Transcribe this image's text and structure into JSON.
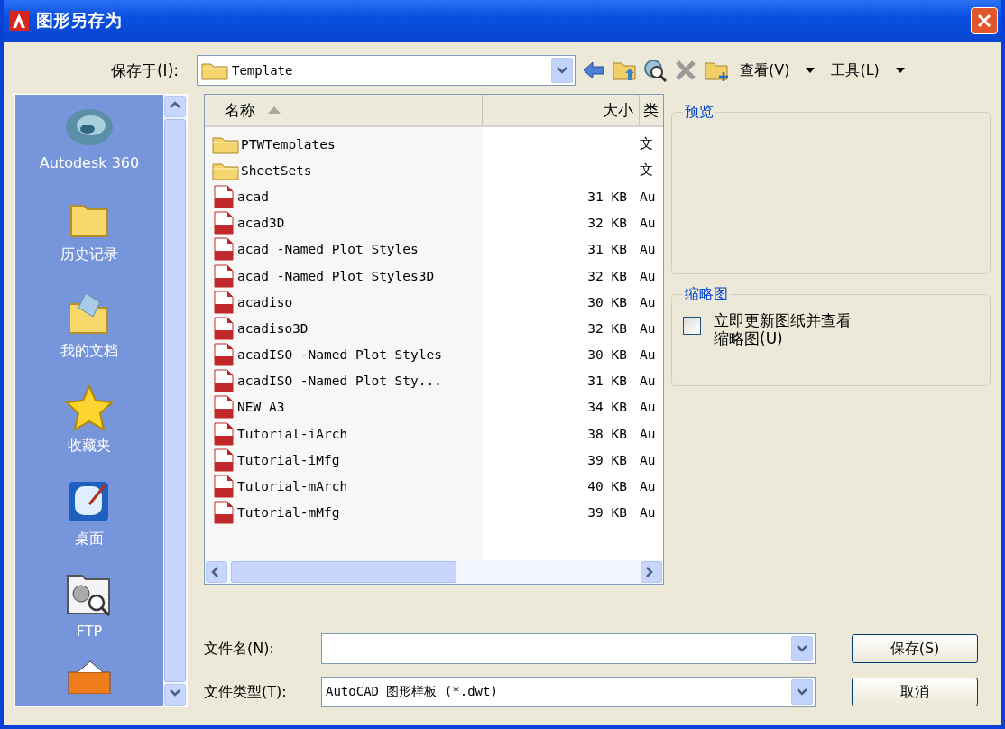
{
  "window": {
    "title": "图形另存为"
  },
  "toolbar": {
    "label": "保存于(I):",
    "location": "Template",
    "menus": [
      "查看(V)",
      "工具(L)"
    ]
  },
  "places": [
    {
      "label": "Autodesk 360"
    },
    {
      "label": "历史记录"
    },
    {
      "label": "我的文档"
    },
    {
      "label": "收藏夹"
    },
    {
      "label": "桌面"
    },
    {
      "label": "FTP"
    }
  ],
  "file_list": {
    "columns": [
      "名称",
      "大小",
      "类"
    ],
    "rows": [
      {
        "kind": "folder",
        "name": "PTWTemplates",
        "size": null,
        "type": "文",
        "selected": false
      },
      {
        "kind": "folder",
        "name": "SheetSets",
        "type": "文",
        "selected": false
      },
      {
        "kind": "dwt",
        "name": "acad",
        "size": "31 KB",
        "type": "Au",
        "selected": false
      },
      {
        "kind": "dwt",
        "name": "acad3D",
        "size": "32 KB",
        "type": "Au",
        "selected": false
      },
      {
        "kind": "dwt",
        "name": "acad -Named Plot Styles",
        "size": "31 KB",
        "type": "Au",
        "selected": false
      },
      {
        "kind": "dwt",
        "name": "acad -Named Plot Styles3D",
        "size": "32 KB",
        "type": "Au",
        "selected": false
      },
      {
        "kind": "dwt",
        "name": "acadiso",
        "size": "30 KB",
        "type": "Au",
        "selected": false
      },
      {
        "kind": "dwt",
        "name": "acadiso3D",
        "size": "32 KB",
        "type": "Au",
        "selected": false
      },
      {
        "kind": "dwt",
        "name": "acadISO -Named Plot Styles",
        "size": "30 KB",
        "type": "Au",
        "selected": false
      },
      {
        "kind": "dwt",
        "name": "acadISO -Named Plot Sty...",
        "size": "31 KB",
        "type": "Au",
        "selected": false
      },
      {
        "kind": "dwt",
        "name": "NEW A3",
        "size": "34 KB",
        "type": "Au",
        "selected": false
      },
      {
        "kind": "dwt",
        "name": "Tutorial-iArch",
        "size": "38 KB",
        "type": "Au",
        "selected": false
      },
      {
        "kind": "dwt",
        "name": "Tutorial-iMfg",
        "size": "39 KB",
        "type": "Au",
        "selected": false
      },
      {
        "kind": "dwt",
        "name": "Tutorial-mArch",
        "size": "40 KB",
        "type": "Au",
        "selected": false
      },
      {
        "kind": "dwt",
        "name": "Tutorial-mMfg",
        "size": "39 KB",
        "type": "Au",
        "selected": false
      }
    ]
  },
  "preview": {
    "title": "预览"
  },
  "thumbnail": {
    "title": "缩略图",
    "checkbox": {
      "label": "立即更新图纸并查看缩略图(U)",
      "checked": false
    }
  },
  "file_name": {
    "label": "文件名(N):"
  },
  "file_type": {
    "label": "文件类型(T):",
    "value": "AutoCAD 图形样板 (*.dwt)"
  },
  "buttons": [
    "保存(S)",
    "取消"
  ]
}
